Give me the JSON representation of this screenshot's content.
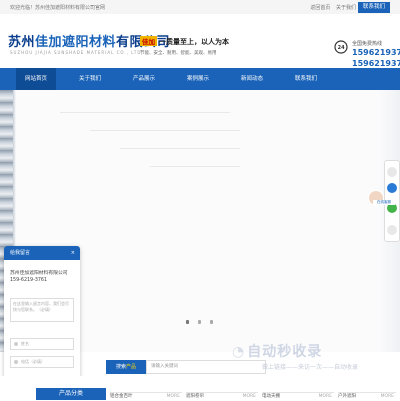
{
  "topbar": {
    "welcome": "欢迎光临！苏州佳加遮阳材料有限公司官网",
    "links": [
      "返回首页",
      "关于我们"
    ],
    "contact_button": "联系我们"
  },
  "header": {
    "logo_prefix": "苏州",
    "logo_highlight": "佳加遮阳材料",
    "logo_suffix": "有限公司",
    "logo_en": "SUZHOU JIAJIA SUNSHADE MATERIAL CO., LTD",
    "slogan_badge": "佳加",
    "slogan": "一质量至上，以人为本",
    "subslogan": "节能、安全、耐用、智能、美观、易用",
    "hotline_label": "全国免费热线",
    "hotline1": "15962193761",
    "hotline2": "15962193761"
  },
  "nav": {
    "items": [
      "网站首页",
      "关于我们",
      "产品展示",
      "案例展示",
      "新闻动态",
      "联系我们"
    ]
  },
  "banner": {
    "slide_count": 3
  },
  "side_tools": {
    "cs_label": "在线客服"
  },
  "chat": {
    "title": "给我留言",
    "close": "×",
    "company": "苏州佳加遮阳材料有限公司159-6219-3761",
    "message_placeholder": "在这里输入留言内容，我们会尽快与您联系。（必填）",
    "name_placeholder": "姓名",
    "phone_placeholder": "电话（必填）",
    "send": "提交"
  },
  "products": {
    "tag_prefix": "搜索",
    "tag_highlight": "产品",
    "search_placeholder": "请输入关键词"
  },
  "watermark": {
    "brand": "自动秒收录",
    "tagline": "做上链接——来访一次——自动收录"
  },
  "footer_strip": {
    "category": "产品分类",
    "items": [
      "铝合金百叶",
      "遮阳卷帘",
      "电动天棚",
      "户外遮阳"
    ],
    "more": "MORE"
  }
}
